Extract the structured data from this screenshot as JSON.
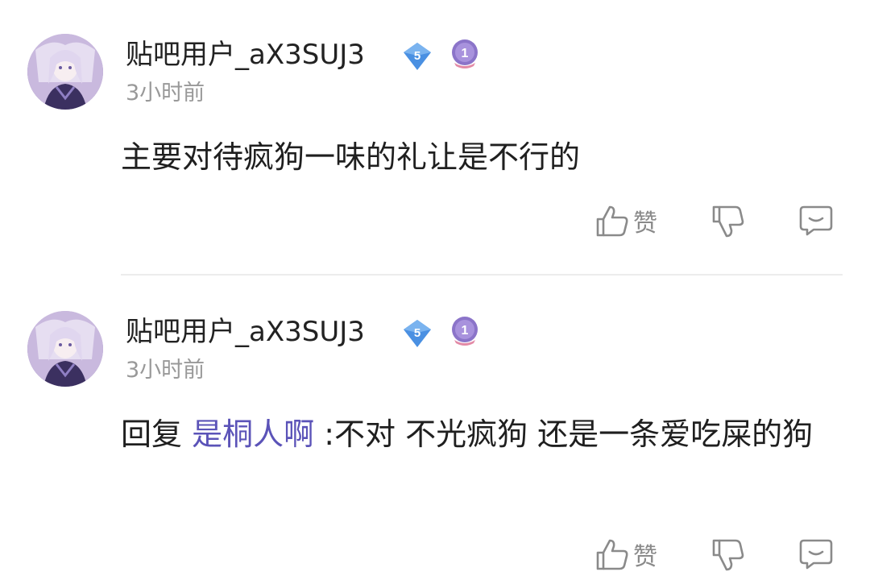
{
  "comments": [
    {
      "username": "贴吧用户_aX3SUJ3",
      "level": "5",
      "medal": "1",
      "time": "3小时前",
      "content": "主要对待疯狗一味的礼让是不行的",
      "reply_prefix": "",
      "reply_target": "",
      "reply_text": "",
      "like_label": "赞"
    },
    {
      "username": "贴吧用户_aX3SUJ3",
      "level": "5",
      "medal": "1",
      "time": "3小时前",
      "content": "",
      "reply_prefix": "回复 ",
      "reply_target": "是桐人啊",
      "reply_text": " :不对 不光疯狗 还是一条爱吃屎的狗",
      "like_label": "赞"
    }
  ],
  "colors": {
    "mention": "#5b53b8",
    "level_badge": "#4a90e2",
    "medal": "#8b74c9",
    "action_icon": "#8a8a8a"
  },
  "icons": [
    "thumbs-up-icon",
    "thumbs-down-icon",
    "reply-icon",
    "level-badge-icon",
    "medal-icon"
  ]
}
